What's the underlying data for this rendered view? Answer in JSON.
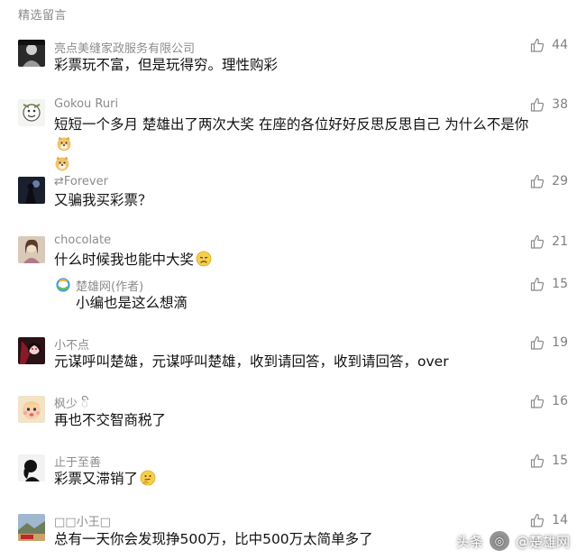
{
  "section": {
    "title": "精选留言"
  },
  "comments": [
    {
      "name": "亮点美缝家政服务有限公司",
      "text": "彩票玩不富，但是玩得穷。理性购彩",
      "likes": "44",
      "avatar_icon": "avatar-portrait-bw"
    },
    {
      "name": "Gokou Ruri",
      "text": "短短一个多月  楚雄出了两次大奖  在座的各位好好反思反思自己  为什么不是你",
      "likes": "38",
      "avatar_icon": "avatar-cartoon",
      "emoji": "doge-emoji"
    },
    {
      "name": "⇄Forever",
      "text": "又骗我买彩票？",
      "likes": "29",
      "avatar_icon": "avatar-dark-figure"
    },
    {
      "name": "chocolate",
      "text": "什么时候我也能中大奖",
      "likes": "21",
      "avatar_icon": "avatar-girl",
      "emoji": "frown-emoji"
    },
    {
      "name": "小不点",
      "text": "元谋呼叫楚雄，元谋呼叫楚雄，收到请回答，收到请回答，over",
      "likes": "19",
      "avatar_icon": "avatar-anime"
    },
    {
      "name": "枫少 ꦼ",
      "text": "再也不交智商税了",
      "likes": "16",
      "avatar_icon": "avatar-baby"
    },
    {
      "name": "止于至善",
      "text": "彩票又滞销了",
      "likes": "15",
      "avatar_icon": "avatar-silhouette",
      "emoji": "thinking-emoji"
    },
    {
      "name": "□□小王□",
      "text": "总有一天你会发现挣500万，比中500万太简单多了",
      "likes": "14",
      "avatar_icon": "avatar-landscape"
    }
  ],
  "author_reply": {
    "name": "楚雄网(作者)",
    "text": "小编也是这么想滴",
    "likes": "15",
    "logo_icon": "chuxiong-logo"
  },
  "watermark": {
    "prefix": "头条",
    "handle": "@楚雄网"
  },
  "colors": {
    "meta_text": "#8c8c8c",
    "body_text": "#111111",
    "like_icon": "#8a8a8a"
  }
}
